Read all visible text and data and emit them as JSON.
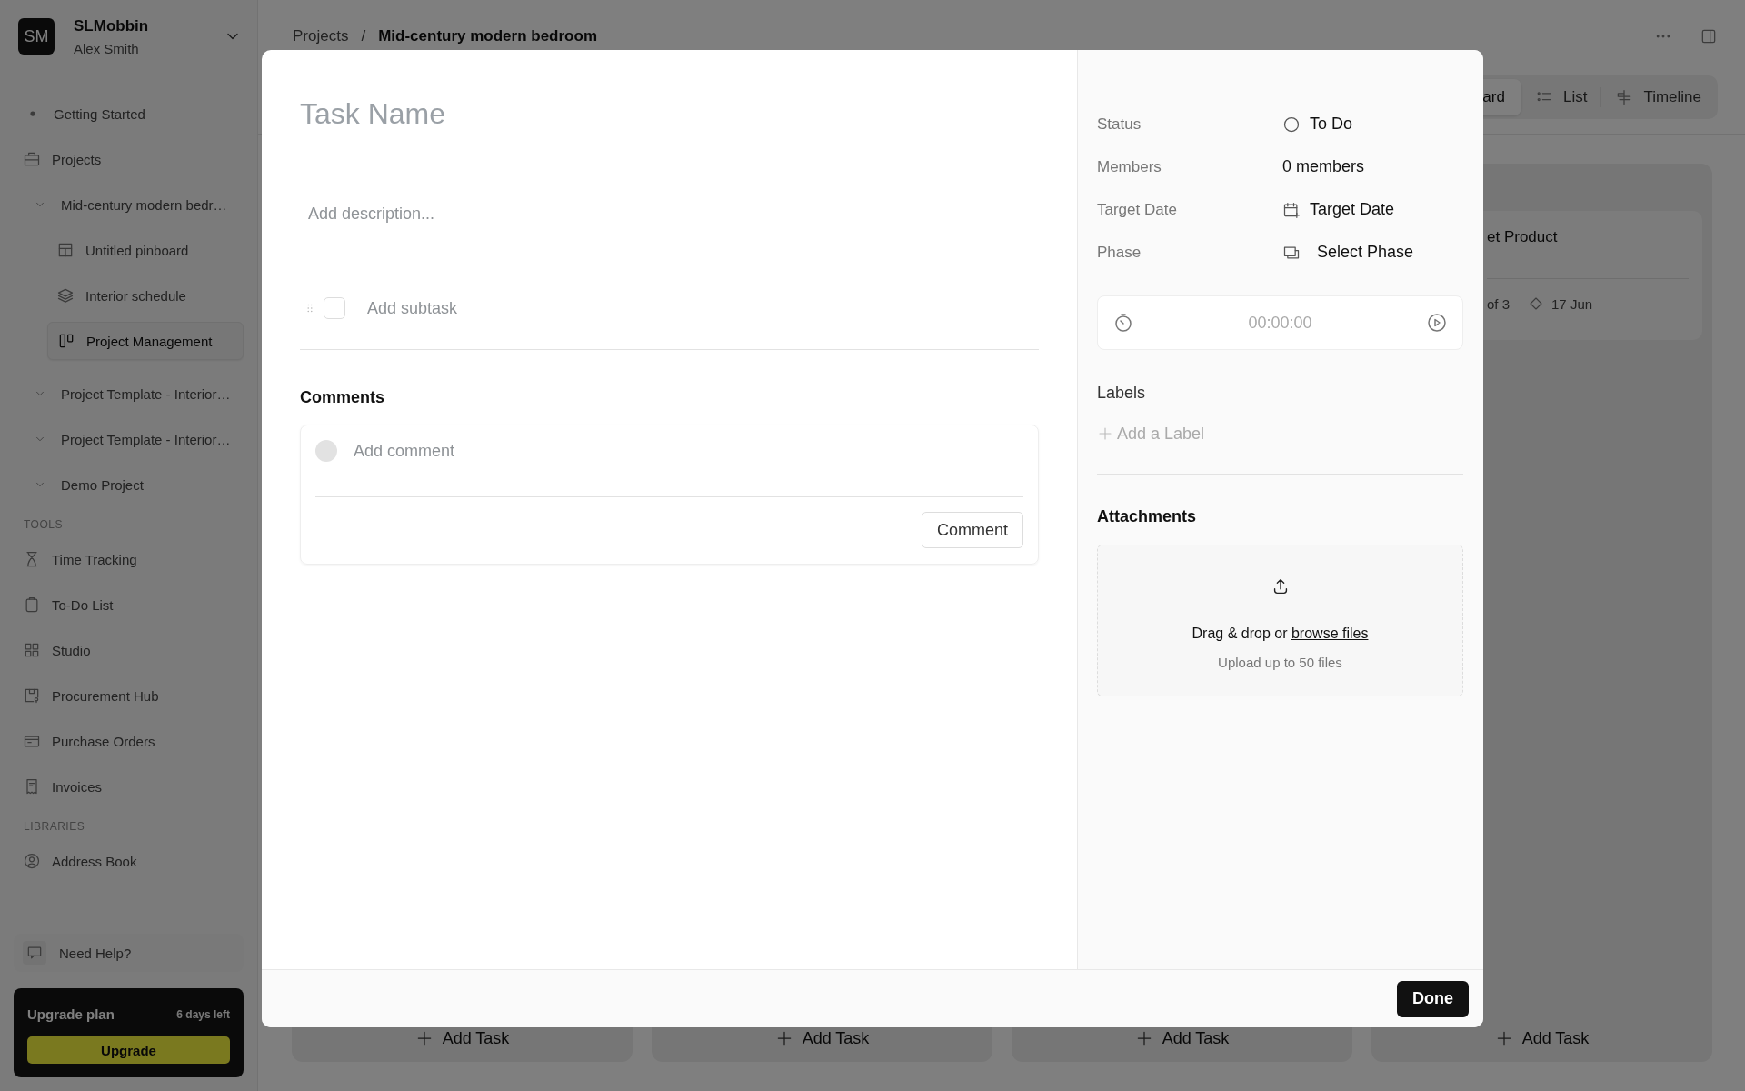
{
  "sidebar": {
    "workspace": {
      "initials": "SM",
      "name": "SLMobbin",
      "user": "Alex Smith"
    },
    "nav": [
      {
        "label": "Getting Started"
      },
      {
        "label": "Projects"
      }
    ],
    "projects": [
      {
        "label": "Mid-century modern bedr…",
        "children": [
          {
            "label": "Untitled pinboard",
            "selected": false
          },
          {
            "label": "Interior schedule",
            "selected": false
          },
          {
            "label": "Project Management",
            "selected": true
          }
        ]
      },
      {
        "label": "Project Template - Interior…"
      },
      {
        "label": "Project Template - Interior…"
      },
      {
        "label": "Demo Project"
      }
    ],
    "sections": [
      {
        "heading": "TOOLS",
        "items": [
          {
            "label": "Time Tracking"
          },
          {
            "label": "To-Do List"
          },
          {
            "label": "Studio"
          },
          {
            "label": "Procurement Hub"
          },
          {
            "label": "Purchase Orders"
          },
          {
            "label": "Invoices"
          }
        ]
      },
      {
        "heading": "LIBRARIES",
        "items": [
          {
            "label": "Address Book"
          }
        ]
      }
    ],
    "help": "Need Help?",
    "upgrade": {
      "title": "Upgrade plan",
      "days_left": "6 days left",
      "button": "Upgrade"
    }
  },
  "breadcrumb": {
    "items": [
      "Projects",
      "Mid-century modern bedroom"
    ],
    "separator": "/"
  },
  "tabs": [
    {
      "label": "ard",
      "selected": true
    },
    {
      "label": "List",
      "selected": false
    },
    {
      "label": "Timeline",
      "selected": false
    }
  ],
  "board": {
    "columns": [
      {
        "add_task": "Add Task"
      },
      {
        "add_task": "Add Task"
      },
      {
        "add_task": "Add Task"
      },
      {
        "add_task": "Add Task",
        "card": {
          "title": "et Product",
          "subtasks": "of 3",
          "date": "17 Jun"
        }
      }
    ]
  },
  "task_modal": {
    "title_placeholder": "Task Name",
    "description_placeholder": "Add description...",
    "subtask": {
      "placeholder": "Add subtask",
      "checked": false
    },
    "comments": {
      "heading": "Comments",
      "placeholder": "Add comment",
      "button": "Comment"
    },
    "properties": [
      {
        "label": "Status",
        "value": "To Do",
        "kind": "status"
      },
      {
        "label": "Members",
        "value": "0 members",
        "kind": "text"
      },
      {
        "label": "Target Date",
        "value": "Target Date",
        "kind": "date"
      },
      {
        "label": "Phase",
        "value": "Select Phase",
        "kind": "phase"
      }
    ],
    "timer": "00:00:00",
    "labels": {
      "heading": "Labels",
      "add": "Add a Label"
    },
    "attachments": {
      "heading": "Attachments",
      "prompt": "Drag & drop or ",
      "link": "browse files",
      "note": "Upload up to 50 files"
    },
    "done_button": "Done"
  }
}
